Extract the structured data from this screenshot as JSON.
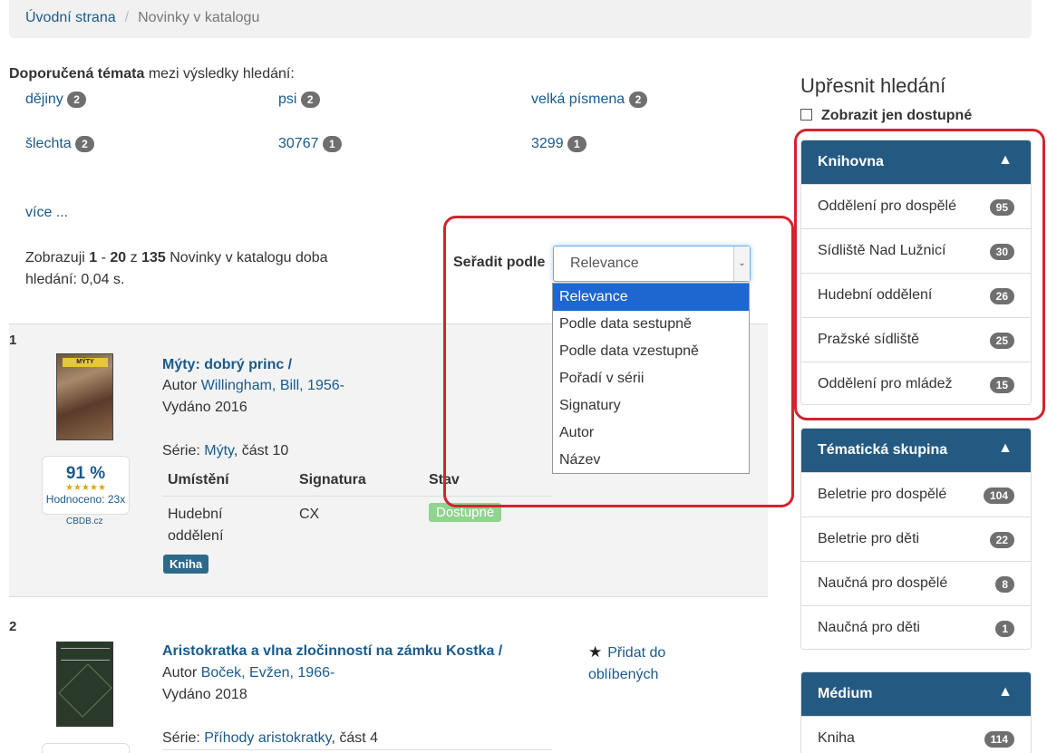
{
  "breadcrumb": {
    "home": "Úvodní strana",
    "current": "Novinky v katalogu"
  },
  "topics": {
    "heading_bold": "Doporučená témata",
    "heading_rest": " mezi výsledky hledání:",
    "items": [
      {
        "label": "dějiny",
        "count": "2"
      },
      {
        "label": "psi",
        "count": "2"
      },
      {
        "label": "velká písmena",
        "count": "2"
      },
      {
        "label": "šlechta",
        "count": "2"
      },
      {
        "label": "30767",
        "count": "1"
      },
      {
        "label": "3299",
        "count": "1"
      }
    ],
    "more": "více ..."
  },
  "results": {
    "prefix": "Zobrazuji ",
    "from": "1",
    "dash": " - ",
    "to": "20",
    "of": " z ",
    "total": "135",
    "suffix": " Novinky v katalogu doba hledání: 0,04 s."
  },
  "sort": {
    "label": "Seřadit podle",
    "selected": "Relevance",
    "options": [
      "Relevance",
      "Podle data sestupně",
      "Podle data vzestupně",
      "Pořadí v sérii",
      "Signatury",
      "Autor",
      "Název"
    ]
  },
  "records": [
    {
      "number": "1",
      "title": "Mýty: dobrý princ /",
      "author_prefix": "Autor ",
      "author": "Willingham, Bill, 1956-",
      "published": "Vydáno 2016",
      "series_prefix": "Série: ",
      "series": "Mýty",
      "series_part": ", část 10",
      "rating": {
        "percent": "91 %",
        "stars": "★★★★★",
        "count_text": "Hodnoceno: 23x",
        "source": "CBDB.cz"
      },
      "holdings": {
        "headers": [
          "Umístění",
          "Signatura",
          "Stav"
        ],
        "rows": [
          {
            "location": "Hudební oddělení",
            "callno": "CX",
            "status": "Dostupné"
          }
        ]
      },
      "format": "Kniha"
    },
    {
      "number": "2",
      "title": "Aristokratka a vlna zločinností na zámku Kostka /",
      "author_prefix": "Autor ",
      "author": "Boček, Evžen, 1966-",
      "published": "Vydáno 2018",
      "series_prefix": "Série: ",
      "series": "Příhody aristokratky",
      "series_part": ", část 4",
      "favorite": "Přidat do oblíbených"
    }
  ],
  "sidebar": {
    "title": "Upřesnit hledání",
    "available_only": "Zobrazit jen dostupné",
    "facets": [
      {
        "title": "Knihovna",
        "toggle": "▲",
        "items": [
          {
            "label": "Oddělení pro dospělé",
            "count": "95"
          },
          {
            "label": "Sídliště Nad Lužnicí",
            "count": "30"
          },
          {
            "label": "Hudební oddělení",
            "count": "26"
          },
          {
            "label": "Pražské sídliště",
            "count": "25"
          },
          {
            "label": "Oddělení pro mládež",
            "count": "15"
          }
        ]
      },
      {
        "title": "Tématická skupina",
        "toggle": "▲",
        "items": [
          {
            "label": "Beletrie pro dospělé",
            "count": "104"
          },
          {
            "label": "Beletrie pro děti",
            "count": "22"
          },
          {
            "label": "Naučná pro dospělé",
            "count": "8"
          },
          {
            "label": "Naučná pro děti",
            "count": "1"
          }
        ]
      },
      {
        "title": "Médium",
        "toggle": "▲",
        "items": [
          {
            "label": "Kniha",
            "count": "114"
          }
        ]
      }
    ]
  },
  "colors": {
    "facet_header": "#245a82",
    "highlight": "#d3232f",
    "link": "#1a5a8a",
    "selected_option": "#1e66d0"
  }
}
